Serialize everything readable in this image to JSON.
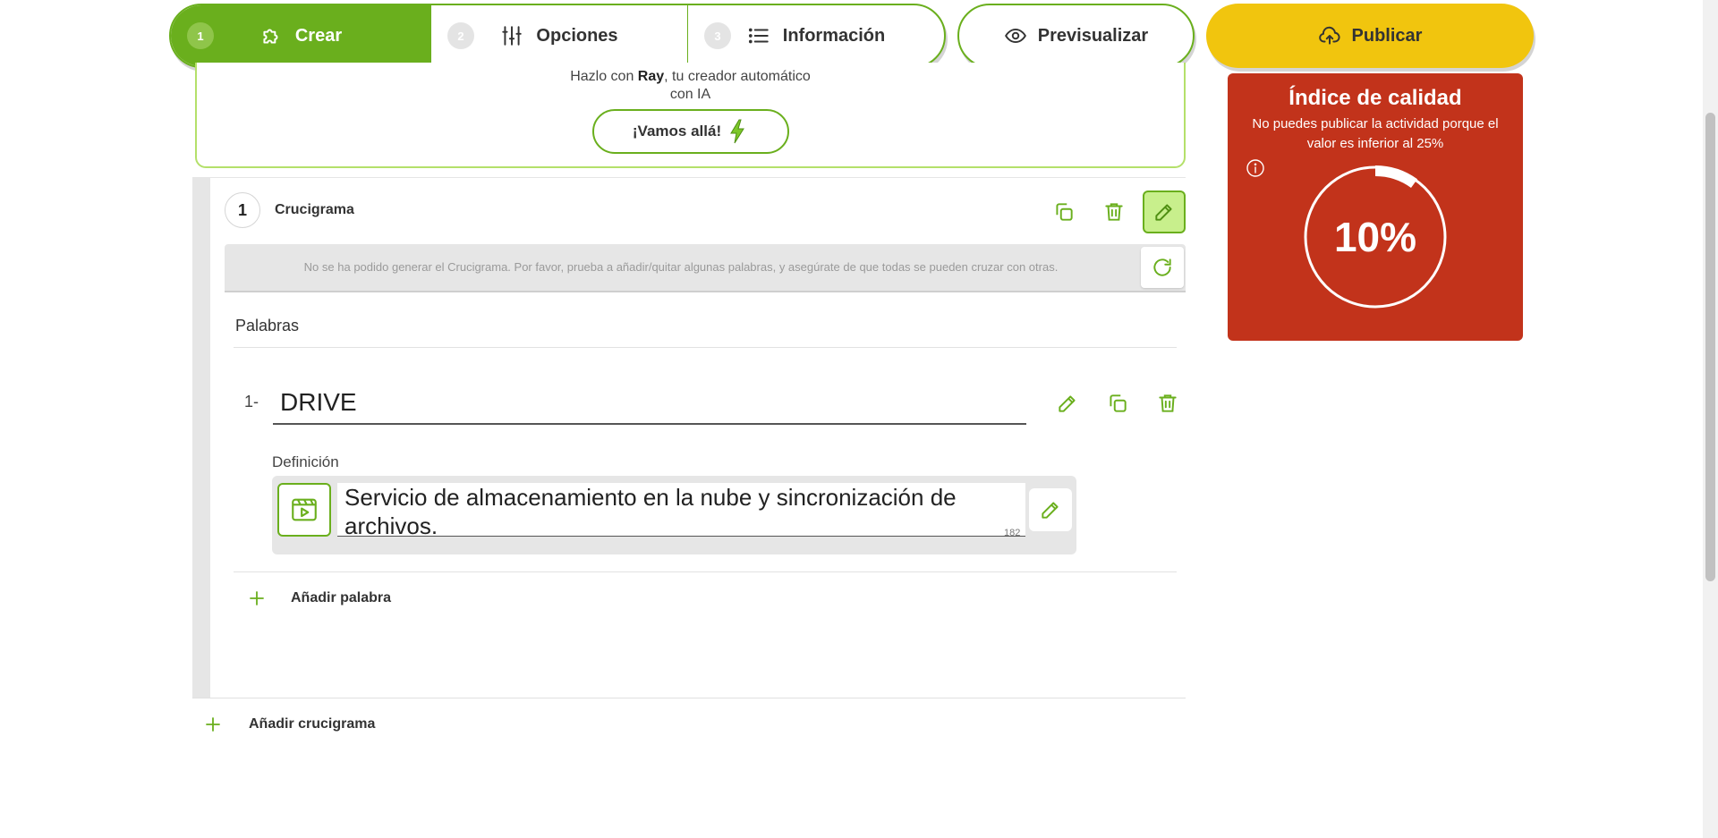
{
  "colors": {
    "accent": "#6aaf1d",
    "publish": "#f1c50e",
    "quality_bg": "#c2331b"
  },
  "steps": [
    {
      "num": "1",
      "label": "Crear",
      "icon": "puzzle-icon",
      "active": true
    },
    {
      "num": "2",
      "label": "Opciones",
      "icon": "sliders-icon",
      "active": false
    },
    {
      "num": "3",
      "label": "Información",
      "icon": "list-icon",
      "active": false
    }
  ],
  "preview": {
    "label": "Previsualizar",
    "icon": "eye-icon"
  },
  "publish": {
    "label": "Publicar",
    "icon": "cloud-upload-icon"
  },
  "ai": {
    "text_prefix": "Hazlo con ",
    "name": "Ray",
    "text_suffix": ", tu creador automático",
    "text_line2": "con IA",
    "button_label": "¡Vamos allá!",
    "button_icon": "lightning-icon"
  },
  "crossword": {
    "number": "1",
    "title": "Crucigrama",
    "error": "No se ha podido generar el Crucigrama. Por favor, prueba a añadir/quitar algunas palabras, y asegúrate de que todas se pueden cruzar con otras.",
    "words_title": "Palabras",
    "words": [
      {
        "index": "1-",
        "value": "DRIVE",
        "definition_label": "Definición",
        "definition": "Servicio de almacenamiento en la nube y sincronización de archivos.",
        "char_count": "182"
      }
    ],
    "add_word_label": "Añadir palabra"
  },
  "add_crossword_label": "Añadir crucigrama",
  "quality": {
    "title": "Índice de calidad",
    "subtitle": "No puedes publicar la actividad porque el valor es inferior al 25%",
    "value_label": "10%",
    "value": 0.1
  }
}
